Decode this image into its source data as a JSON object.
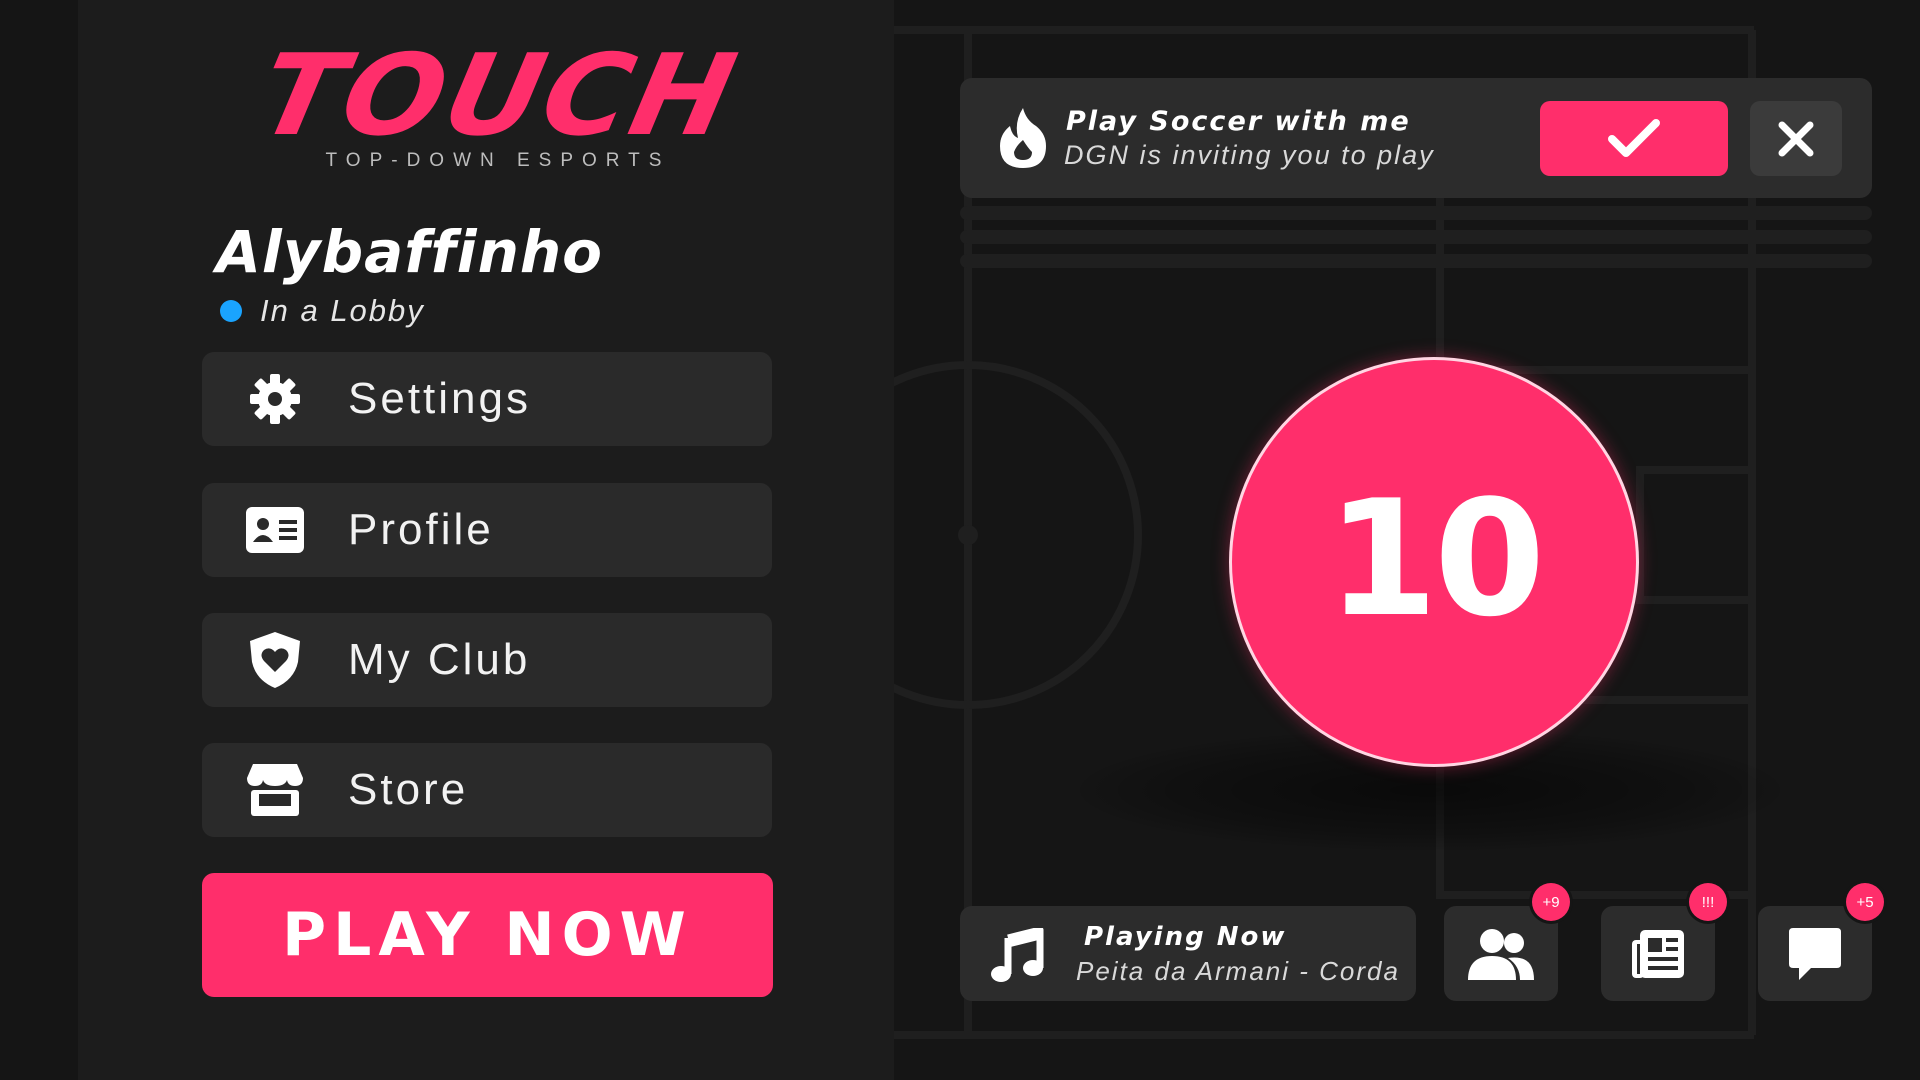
{
  "brand": {
    "logo_text": "TOUCH",
    "tagline": "TOP-DOWN ESPORTS",
    "accent_color": "#ff2e6b"
  },
  "player": {
    "username": "Alybaffinho",
    "status": "In a Lobby",
    "status_color": "#1aa4ff"
  },
  "menu": {
    "items": [
      {
        "label": "Settings",
        "icon": "gear-icon"
      },
      {
        "label": "Profile",
        "icon": "id-card-icon"
      },
      {
        "label": "My Club",
        "icon": "shield-heart-icon"
      },
      {
        "label": "Store",
        "icon": "store-icon"
      }
    ],
    "play_label": "PLAY NOW"
  },
  "invite": {
    "icon": "fire-icon",
    "title": "Play Soccer with me",
    "subtitle": "DGN is inviting you to play",
    "accept_icon": "check-icon",
    "decline_icon": "close-icon"
  },
  "countdown": {
    "value": "10"
  },
  "now_playing": {
    "icon": "music-note-icon",
    "title": "Playing Now",
    "track": "Peita da Armani - Corda"
  },
  "quick_buttons": [
    {
      "icon": "friends-icon",
      "badge": "+9"
    },
    {
      "icon": "news-icon",
      "badge": "!!!"
    },
    {
      "icon": "chat-icon",
      "badge": "+5"
    }
  ]
}
